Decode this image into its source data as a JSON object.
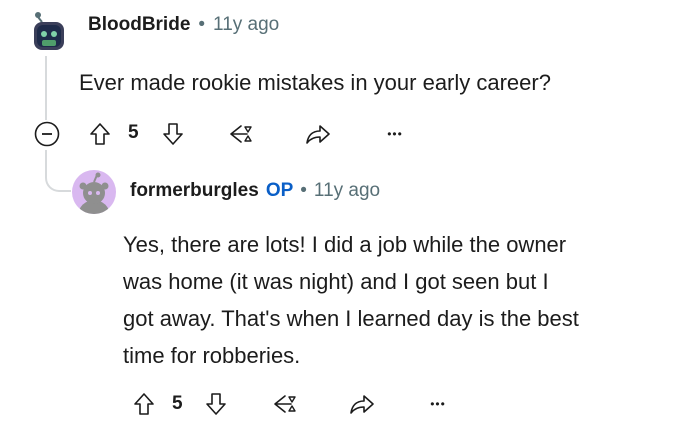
{
  "comment": {
    "username": "BloodBride",
    "separator": "•",
    "age": "11y ago",
    "body": "Ever made rookie mistakes in your early career?",
    "votes": "5",
    "more_label": "•••"
  },
  "reply": {
    "username": "formerburgles",
    "op_badge": "OP",
    "separator": "•",
    "age": "11y ago",
    "body_lines": [
      "Yes, there are lots! I did a job while the owner",
      "was home (it was night) and I got seen but I",
      "got away. That's when I learned day is the best",
      "time for robberies."
    ],
    "votes": "5",
    "more_label": "•••"
  },
  "icons": {
    "collapse": "collapse-minus-icon",
    "upvote": "upvote-arrow-icon",
    "downvote": "downvote-arrow-icon",
    "award": "award-icon",
    "share": "share-arrow-icon",
    "more": "more-options-icon"
  },
  "colors": {
    "text": "#1c1c1c",
    "meta": "#576f76",
    "op": "#0a5fc7",
    "thread": "#d7dadc",
    "reply_avatar_bg": "#d9b8f0"
  }
}
